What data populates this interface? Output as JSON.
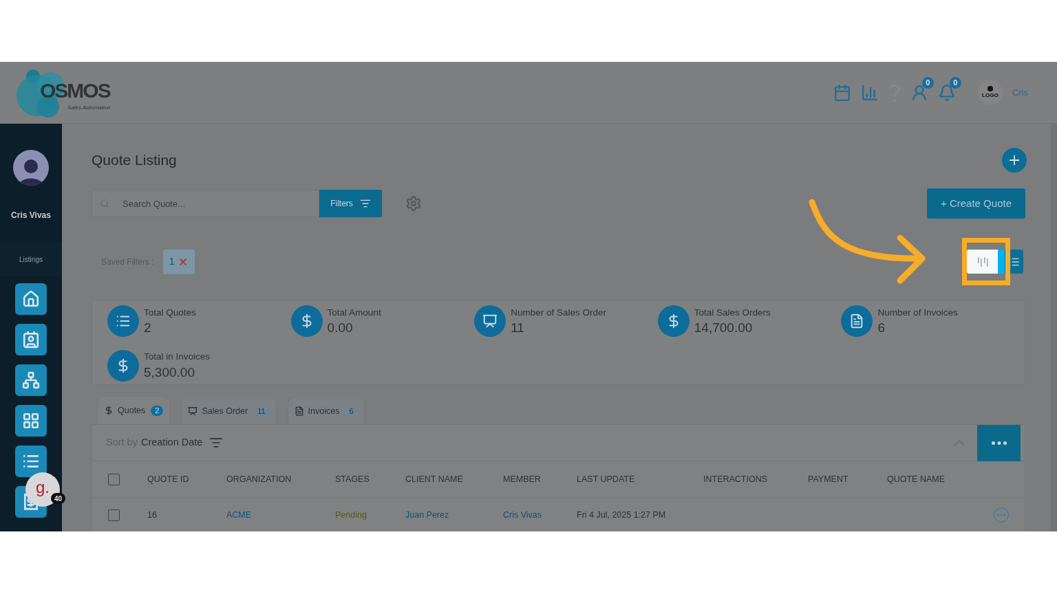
{
  "header": {
    "logo": {
      "name": "OSMOS",
      "tagline": "Sales Automation"
    },
    "actions": [
      {
        "kind": "calendar"
      },
      {
        "kind": "reports"
      },
      {
        "kind": "help"
      },
      {
        "kind": "reminders",
        "badge": "0"
      },
      {
        "kind": "notifications",
        "badge": "0"
      }
    ],
    "company_logo": "LOGO",
    "user": "Cris"
  },
  "sidebar": {
    "user_name": "Cris Vivas",
    "section_label": "Listings",
    "items": [
      {
        "kind": "home"
      },
      {
        "kind": "contacts"
      },
      {
        "kind": "organizations"
      },
      {
        "kind": "dashboard"
      },
      {
        "kind": "list"
      },
      {
        "kind": "invoices"
      }
    ]
  },
  "chat_widget": {
    "logo_text": "g.",
    "badge": "40"
  },
  "page": {
    "title": "Quote Listing",
    "search_placeholder": "Search Quote...",
    "filters_button": "Filters",
    "create_button": "+ Create Quote",
    "saved_filters": {
      "label": "Saved Filters :",
      "chips": [
        {
          "label": "1"
        }
      ]
    },
    "view_toggle": [
      {
        "kind": "columns",
        "selected": false
      },
      {
        "kind": "list",
        "selected": true
      }
    ]
  },
  "stats": [
    {
      "kind": "list",
      "label": "Total Quotes",
      "value": "2"
    },
    {
      "kind": "dollar",
      "label": "Total Amount",
      "value": "0.00"
    },
    {
      "kind": "board",
      "label": "Number of Sales Order",
      "value": "11"
    },
    {
      "kind": "dollar",
      "label": "Total Sales Orders",
      "value": "14,700.00"
    },
    {
      "kind": "document",
      "label": "Number of Invoices",
      "value": "6"
    },
    {
      "kind": "dollar",
      "label": "Total in Invoices",
      "value": "5,300.00"
    }
  ],
  "tabs": [
    {
      "kind": "dollar",
      "label": "Quotes",
      "count": "2",
      "selected": true
    },
    {
      "kind": "board",
      "label": "Sales Order",
      "count": "11",
      "selected": false
    },
    {
      "kind": "document",
      "label": "Invoices",
      "count": "6",
      "selected": false
    }
  ],
  "sort": {
    "prefix": "Sort by",
    "field": "Creation Date"
  },
  "table": {
    "select_all_checked": false,
    "columns": [
      "QUOTE ID",
      "ORGANIZATION",
      "STAGES",
      "CLIENT NAME",
      "MEMBER",
      "LAST UPDATE",
      "INTERACTIONS",
      "PAYMENT",
      "QUOTE NAME"
    ],
    "rows": [
      {
        "checked": false,
        "quote_id": "16",
        "organization": "ACME",
        "stage": "Pending",
        "client_name": "Juan Perez",
        "member": "Cris Vivas",
        "last_update": "Fri 4 Jul, 2025 1:27 PM"
      }
    ]
  }
}
